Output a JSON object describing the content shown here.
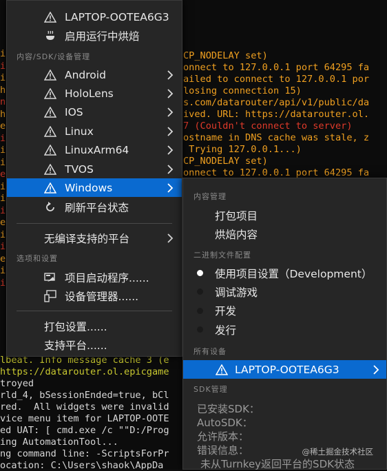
{
  "terminal": {
    "right_lines": [
      {
        "text": "CP_NODELAY set)",
        "color": "orange"
      },
      {
        "text": "onnect to 127.0.0.1 port 64295 fa",
        "color": "orange"
      },
      {
        "text": "ailed to connect to 127.0.0.1 por",
        "color": "orange"
      },
      {
        "text": "losing connection 15)",
        "color": "orange"
      },
      {
        "text": "s.com/datarouter/api/v1/public/da",
        "color": "orange"
      },
      {
        "text": "ived. URL: https://datarouter.ol.",
        "color": "orange"
      },
      {
        "text": "7 (Couldn't connect to server)",
        "color": "red"
      },
      {
        "text": "ostname in DNS cache was stale, z",
        "color": "orange"
      },
      {
        "text": " Trying 127.0.0.1...)",
        "color": "orange"
      },
      {
        "text": "CP_NODELAY set)",
        "color": "orange"
      },
      {
        "text": "onnect to 127.0.0.1 port 64295 fa",
        "color": "orange"
      }
    ],
    "bottom_lines": [
      {
        "text": "lbeat. Info message cache 3 (e",
        "color": "yellowgreen"
      },
      {
        "text": "https://datarouter.ol.epicgame",
        "color": "yellowgreen"
      },
      {
        "text": "troyed",
        "color": "white"
      },
      {
        "text": "rld_4, bSessionEnded=true, bCl",
        "color": "white"
      },
      {
        "text": "red.  All widgets were invalid",
        "color": "white"
      },
      {
        "text": "vice menu item for LAPTOP-OOTE",
        "color": "white"
      },
      {
        "text": "ed UAT: [ cmd.exe /c \"\"D:/Prog",
        "color": "white"
      },
      {
        "text": "ing AutomationTool...",
        "color": "white"
      },
      {
        "text": "ng command line: -ScriptsForPr",
        "color": "white"
      },
      {
        "text": "ocation: C:\\Users\\shaok\\AppDa",
        "color": "white"
      }
    ],
    "left_fragments": [
      "i",
      "i",
      "i",
      "h",
      "n",
      "h",
      "e",
      "i",
      "i",
      "i",
      "e",
      "i",
      "i",
      "i",
      "e",
      "i",
      "i",
      "e",
      "i",
      "i"
    ]
  },
  "menu": {
    "device": "LAPTOP-OOTEA6G3",
    "bake_running": "启用运行中烘焙",
    "section_platforms": "内容/SDK/设备管理",
    "platforms": [
      "Android",
      "HoloLens",
      "IOS",
      "Linux",
      "LinuxArm64",
      "TVOS",
      "Windows"
    ],
    "refresh": "刷新平台状态",
    "unsupported": "无编译支持的平台",
    "section_options": "选项和设置",
    "project_launcher": "项目启动程序......",
    "device_manager": "设备管理器......",
    "packaging_settings": "打包设置......",
    "supported_platforms": "支持平台......"
  },
  "submenu": {
    "section_content": "内容管理",
    "package_project": "打包项目",
    "cook_content": "烘焙内容",
    "section_binary": "二进制文件配置",
    "configs": [
      "使用项目设置（Development）",
      "调试游戏",
      "开发",
      "发行"
    ],
    "section_devices": "所有设备",
    "device": "LAPTOP-OOTEA6G3",
    "section_sdk": "SDK管理",
    "installed_sdk": "已安装SDK：",
    "auto_sdk": "AutoSDK：",
    "allowed_version": "允许版本：",
    "error_info": "错误信息：",
    "turnkey_status": "未从Turnkey返回平台的SDK状态"
  },
  "watermark": "@稀土掘金技术社区",
  "colors": {
    "accent": "#0a6ad0",
    "menu_bg": "#262626",
    "log_orange": "#f0a020",
    "log_red": "#e03a2a"
  }
}
